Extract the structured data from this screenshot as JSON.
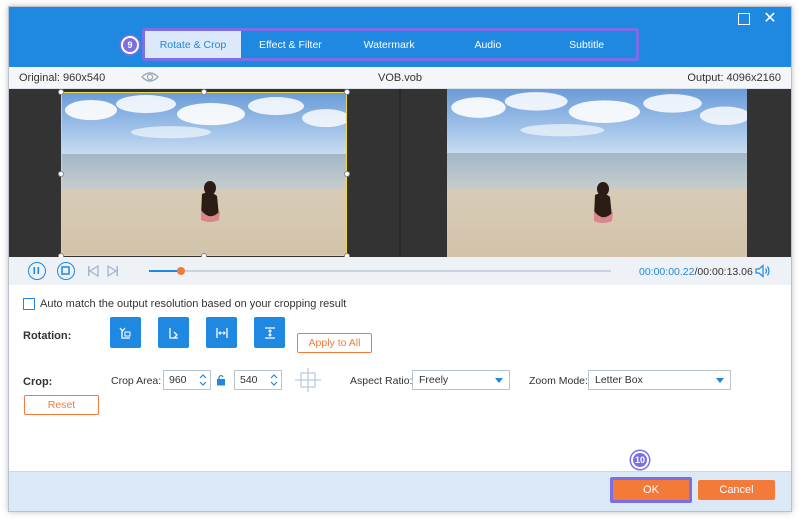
{
  "colors": {
    "accent": "#1f88e0",
    "orange": "#f47a3a",
    "highlight": "#7b6fe8",
    "crop_border": "#f0d84a"
  },
  "tabs": [
    {
      "label": "Rotate & Crop",
      "active": true
    },
    {
      "label": "Effect & Filter",
      "active": false
    },
    {
      "label": "Watermark",
      "active": false
    },
    {
      "label": "Audio",
      "active": false
    },
    {
      "label": "Subtitle",
      "active": false
    }
  ],
  "badges": {
    "tabs_step": "9",
    "ok_step": "10"
  },
  "info": {
    "original": "Original: 960x540",
    "filename": "VOB.vob",
    "output": "Output: 4096x2160"
  },
  "playback": {
    "current_time": "00:00:00.22",
    "separator": "/",
    "total_time": "00:00:13.06",
    "progress": 0.07
  },
  "options": {
    "auto_match_label": "Auto match the output resolution based on your cropping result",
    "auto_match_checked": false
  },
  "rotation": {
    "label": "Rotation:",
    "apply_label": "Apply to All",
    "icons": [
      "rotate-left-icon",
      "rotate-right-icon",
      "flip-horizontal-icon",
      "flip-vertical-icon"
    ]
  },
  "crop": {
    "label": "Crop:",
    "area_label": "Crop Area:",
    "width": "960",
    "height": "540",
    "aspect_label": "Aspect Ratio:",
    "aspect_value": "Freely",
    "zoom_label": "Zoom Mode:",
    "zoom_value": "Letter Box",
    "reset_label": "Reset"
  },
  "footer": {
    "ok_label": "OK",
    "cancel_label": "Cancel"
  }
}
